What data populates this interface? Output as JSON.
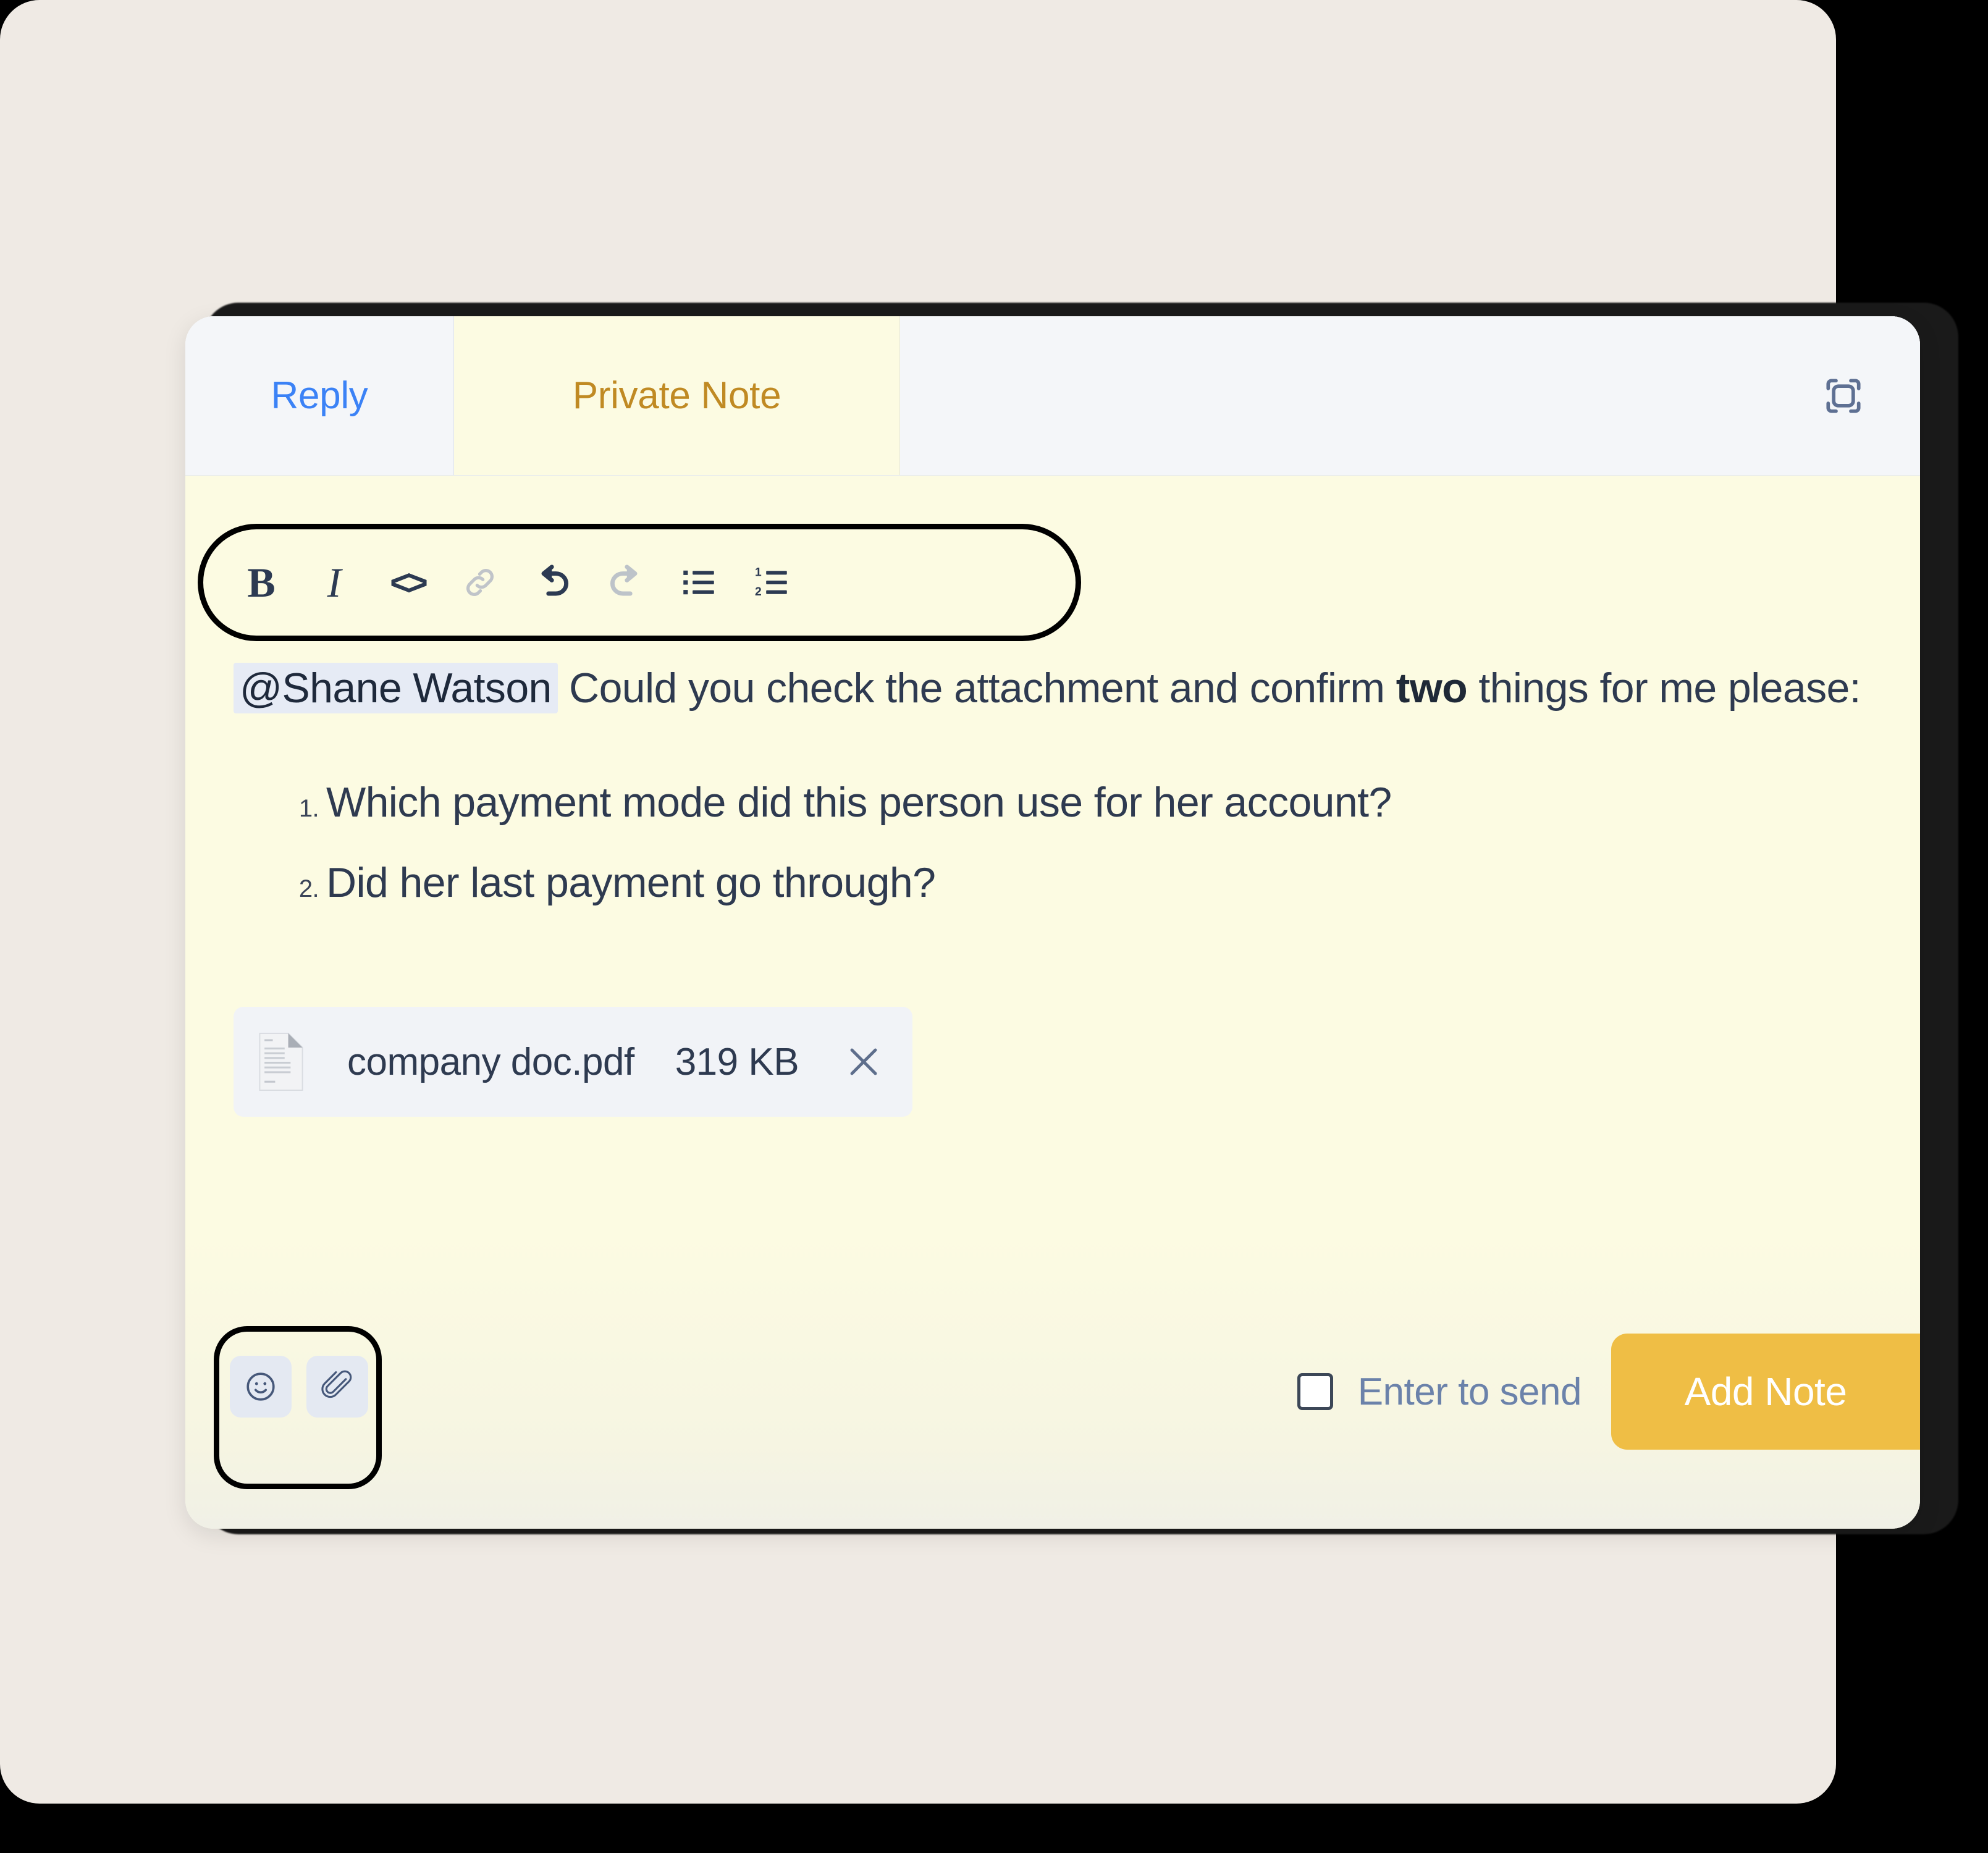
{
  "tabs": [
    {
      "id": "reply",
      "label": "Reply",
      "active": false,
      "color": "#3B82F6"
    },
    {
      "id": "private_note",
      "label": "Private Note",
      "active": true,
      "color": "#C08A23"
    }
  ],
  "header": {
    "expand_icon": "expand-fullscreen-icon"
  },
  "format_toolbar": {
    "buttons": [
      {
        "id": "bold",
        "glyph": "B",
        "icon": "bold-icon",
        "state": "enabled"
      },
      {
        "id": "italic",
        "glyph": "I",
        "icon": "italic-icon",
        "state": "enabled"
      },
      {
        "id": "code",
        "glyph": "<>",
        "icon": "code-icon",
        "state": "enabled"
      },
      {
        "id": "link",
        "glyph": "",
        "icon": "link-icon",
        "state": "disabled"
      },
      {
        "id": "undo",
        "glyph": "",
        "icon": "undo-icon",
        "state": "enabled"
      },
      {
        "id": "redo",
        "glyph": "",
        "icon": "redo-icon",
        "state": "disabled"
      },
      {
        "id": "bullet_list",
        "glyph": "",
        "icon": "bullet-list-icon",
        "state": "enabled"
      },
      {
        "id": "numbered_list",
        "glyph": "",
        "icon": "numbered-list-icon",
        "state": "enabled"
      }
    ]
  },
  "note": {
    "mention": "@Shane Watson",
    "body_part1": " Could you check the attachment and confirm ",
    "body_bold": "two",
    "body_part2": " things for me please:",
    "list": [
      {
        "number": "1.",
        "text": "Which payment mode did this person use for her account?"
      },
      {
        "number": "2.",
        "text": "Did her last payment go through?"
      }
    ]
  },
  "attachment": {
    "file_icon": "file-document-icon",
    "name": "company doc.pdf",
    "size": "319 KB",
    "remove_icon": "close-icon"
  },
  "bottom_bar": {
    "emoji_icon": "emoji-smiley-icon",
    "attach_icon": "paperclip-icon",
    "enter_to_send_label": "Enter to send",
    "enter_to_send_checked": false,
    "submit_label": "Add Note"
  },
  "colors": {
    "page_background": "#000000",
    "backdrop_panel": "#EFEAE4",
    "card_note_bg": "#FCFBE2",
    "tab_bar_bg": "#F4F6F9",
    "accent_amber": "#EFBE45",
    "reply_blue": "#3B82F6",
    "note_gold": "#C08A23",
    "text_slate": "#2E3A50",
    "mention_bg": "#E6EBF5",
    "attachment_bg": "#F1F3F7",
    "tool_btn_bg": "#E4E9F2",
    "enter_send_text": "#6B82AA"
  }
}
